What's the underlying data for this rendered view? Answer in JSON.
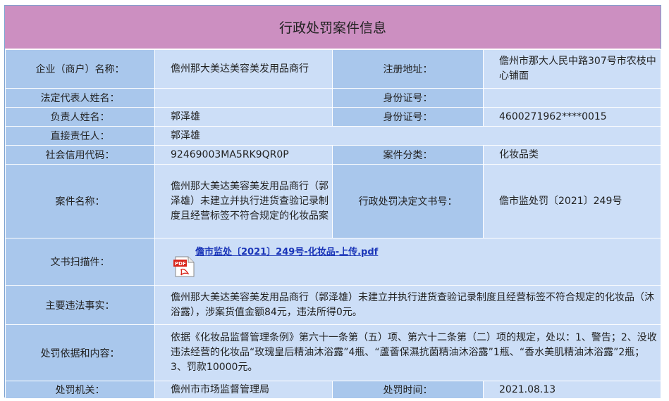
{
  "title": "行政处罚案件信息",
  "rows": {
    "r1": {
      "l1": "企业（商户）名称：",
      "v1": "儋州那大美达美容美发用品商行",
      "l2": "注册地址：",
      "v2": "儋州市那大人民中路307号市农枝中心铺面"
    },
    "r2": {
      "l1": "法定代表人姓名：",
      "v1": "",
      "l2": "身份证号：",
      "v2": ""
    },
    "r3": {
      "l1": "负责人姓名：",
      "v1": "郭泽雄",
      "l2": "身份证号：",
      "v2": "4600271962****0015"
    },
    "r4": {
      "l1": "直接责任人：",
      "v1": "郭泽雄"
    },
    "r5": {
      "l1": "社会信用代码：",
      "v1": "92469003MA5RK9QR0P",
      "l2": "案件分类：",
      "v2": "化妆品类"
    },
    "r6": {
      "l1": "案件名称：",
      "v1": "儋州那大美达美容美发用品商行（郭泽雄）未建立并执行进货查验记录制度且经营标签不符合规定的化妆品案",
      "l2": "行政处罚决定文书号：",
      "v2": "儋市监处罚〔2021〕249号"
    },
    "r7": {
      "l1": "文书扫描件：",
      "link": "儋市监处〔2021〕249号-化妆品-上传.pdf",
      "icon": "pdf-file-icon"
    },
    "r8": {
      "l1": "主要违法事实：",
      "v1": "儋州那大美达美容美发用品商行（郭泽雄）未建立并执行进货查验记录制度且经营标签不符合规定的化妆品（沐浴露），涉案货值金额84元，违法所得0元。"
    },
    "r9": {
      "l1": "处罚依据和内容：",
      "v1": "依据《化妆品监督管理条例》第六十一条第（五）项、第六十二条第（二）项的规定，处以：1、警告；2、没收违法经营的化妆品“玫瑰皇后精油沐浴露”4瓶、“蘆薈保濕抗菌精油沐浴露”1瓶、“香水美肌精油沐浴露”2瓶；3、罚款10000元。"
    },
    "r10": {
      "l1": "处罚机关：",
      "v1": "儋州市市场监督管理局",
      "l2": "处罚时间：",
      "v2": "2021.08.13"
    }
  }
}
